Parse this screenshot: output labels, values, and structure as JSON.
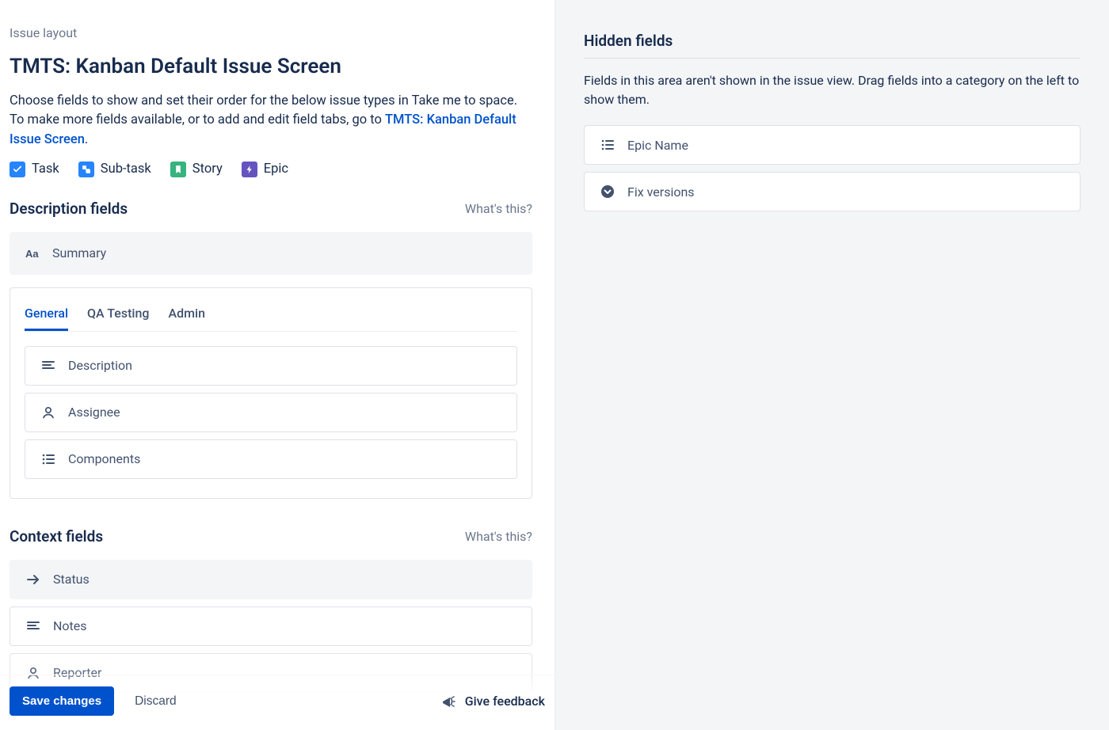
{
  "breadcrumb": "Issue layout",
  "title": "TMTS: Kanban Default Issue Screen",
  "intro_1": "Choose fields to show and set their order for the below issue types in Take me to space. To make more fields available, or to add and edit field tabs, go to ",
  "intro_link": "TMTS: Kanban Default Issue Screen",
  "intro_2": ".",
  "issue_types": [
    {
      "label": "Task",
      "color": "#2684FF"
    },
    {
      "label": "Sub-task",
      "color": "#2684FF"
    },
    {
      "label": "Story",
      "color": "#36B37E"
    },
    {
      "label": "Epic",
      "color": "#6554C0"
    }
  ],
  "whats_this": "What's this?",
  "description_section": {
    "heading": "Description fields",
    "fixed_field": "Summary",
    "tabs": [
      "General",
      "QA Testing",
      "Admin"
    ],
    "active_tab": 0,
    "fields": [
      {
        "icon": "paragraph",
        "label": "Description"
      },
      {
        "icon": "person",
        "label": "Assignee"
      },
      {
        "icon": "list",
        "label": "Components"
      }
    ]
  },
  "context_section": {
    "heading": "Context fields",
    "fields": [
      {
        "icon": "arrow",
        "label": "Status"
      },
      {
        "icon": "paragraph",
        "label": "Notes"
      },
      {
        "icon": "person",
        "label": "Reporter"
      }
    ]
  },
  "footer": {
    "save": "Save changes",
    "discard": "Discard",
    "feedback": "Give feedback"
  },
  "hidden": {
    "heading": "Hidden fields",
    "intro": "Fields in this area aren't shown in the issue view. Drag fields into a category on the left to show them.",
    "fields": [
      {
        "icon": "list",
        "label": "Epic Name"
      },
      {
        "icon": "chevdown",
        "label": "Fix versions"
      }
    ]
  }
}
